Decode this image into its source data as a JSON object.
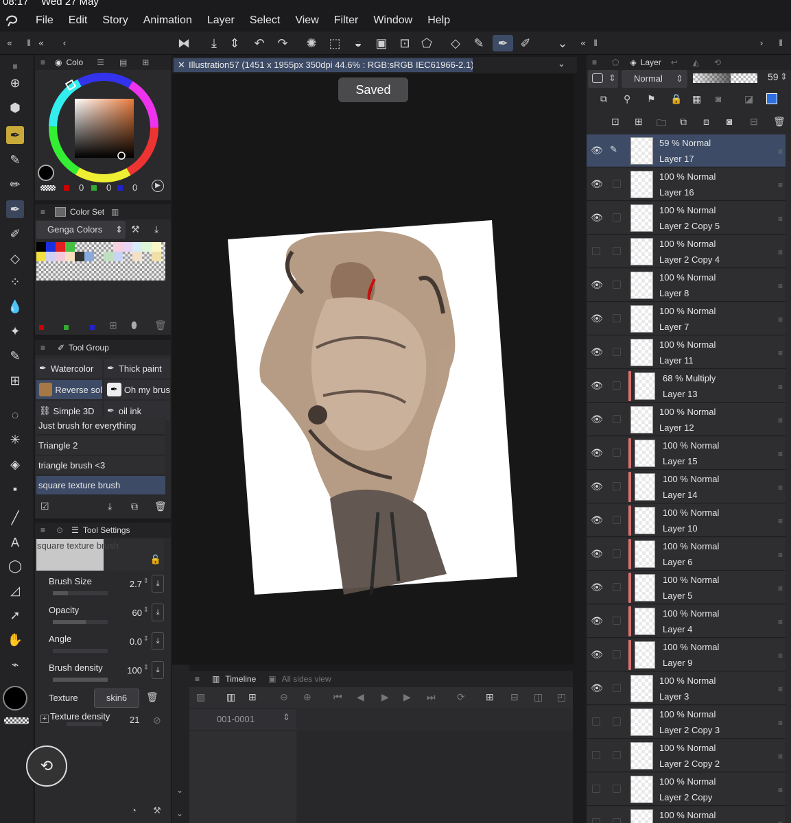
{
  "status_bar": {
    "time": "08:17",
    "date": "Wed 27 May"
  },
  "menu": [
    "File",
    "Edit",
    "Story",
    "Animation",
    "Layer",
    "Select",
    "View",
    "Filter",
    "Window",
    "Help"
  ],
  "toast": "Saved",
  "document": {
    "tab_title": "Illustration57 (1451 x 1955px 350dpi 44.6% : RGB:sRGB IEC61966-2.1)"
  },
  "color_panel": {
    "title": "Colo",
    "r": "0",
    "g": "0",
    "b": "0"
  },
  "color_set": {
    "title": "Color Set",
    "selected": "Genga Colors"
  },
  "tool_group": {
    "title": "Tool Group",
    "cells": [
      "Watercolor",
      "Thick paint",
      "Reverse sol",
      "Oh my brus",
      "Simple 3D",
      "oil ink"
    ],
    "list": [
      "Just brush for everything",
      "Triangle 2",
      "triangle brush <3",
      "square texture brush"
    ]
  },
  "tool_settings": {
    "title": "Tool Settings",
    "brush_name": "square texture brush",
    "settings": [
      {
        "label": "Brush Size",
        "value": "2.7",
        "level": 0.27
      },
      {
        "label": "Opacity",
        "value": "60",
        "level": 0.6
      },
      {
        "label": "Angle",
        "value": "0.0",
        "level": 0.0
      },
      {
        "label": "Brush density",
        "value": "100",
        "level": 1.0
      }
    ],
    "texture_label": "Texture",
    "texture_value": "skin6",
    "texture_density_label": "Texture density",
    "texture_density_value": "21"
  },
  "timeline": {
    "title": "Timeline",
    "tab2": "All sides view",
    "frame": "001-0001"
  },
  "layer_panel": {
    "title": "Layer",
    "blend_mode": "Normal",
    "opacity": "59",
    "layers": [
      {
        "mode": "59 % Normal",
        "name": "Layer 17",
        "visible": true,
        "clip": false,
        "selected": true
      },
      {
        "mode": "100 % Normal",
        "name": "Layer 16",
        "visible": true,
        "clip": false
      },
      {
        "mode": "100 % Normal",
        "name": "Layer 2 Copy 5",
        "visible": true,
        "clip": false
      },
      {
        "mode": "100 % Normal",
        "name": "Layer 2 Copy 4",
        "visible": false,
        "clip": false
      },
      {
        "mode": "100 % Normal",
        "name": "Layer 8",
        "visible": true,
        "clip": false
      },
      {
        "mode": "100 % Normal",
        "name": "Layer 7",
        "visible": true,
        "clip": false
      },
      {
        "mode": "100 % Normal",
        "name": "Layer 11",
        "visible": true,
        "clip": false
      },
      {
        "mode": "68 % Multiply",
        "name": "Layer 13",
        "visible": true,
        "clip": true
      },
      {
        "mode": "100 % Normal",
        "name": "Layer 12",
        "visible": true,
        "clip": false
      },
      {
        "mode": "100 % Normal",
        "name": "Layer 15",
        "visible": true,
        "clip": true
      },
      {
        "mode": "100 % Normal",
        "name": "Layer 14",
        "visible": true,
        "clip": true
      },
      {
        "mode": "100 % Normal",
        "name": "Layer 10",
        "visible": true,
        "clip": true
      },
      {
        "mode": "100 % Normal",
        "name": "Layer 6",
        "visible": true,
        "clip": true
      },
      {
        "mode": "100 % Normal",
        "name": "Layer 5",
        "visible": true,
        "clip": true
      },
      {
        "mode": "100 % Normal",
        "name": "Layer 4",
        "visible": true,
        "clip": true
      },
      {
        "mode": "100 % Normal",
        "name": "Layer 9",
        "visible": true,
        "clip": true
      },
      {
        "mode": "100 % Normal",
        "name": "Layer 3",
        "visible": true,
        "clip": false
      },
      {
        "mode": "100 % Normal",
        "name": "Layer 2 Copy 3",
        "visible": false,
        "clip": false
      },
      {
        "mode": "100 % Normal",
        "name": "Layer 2 Copy 2",
        "visible": false,
        "clip": false
      },
      {
        "mode": "100 % Normal",
        "name": "Layer 2 Copy",
        "visible": false,
        "clip": false
      },
      {
        "mode": "100 % Normal",
        "name": "",
        "visible": false,
        "clip": false
      }
    ]
  }
}
